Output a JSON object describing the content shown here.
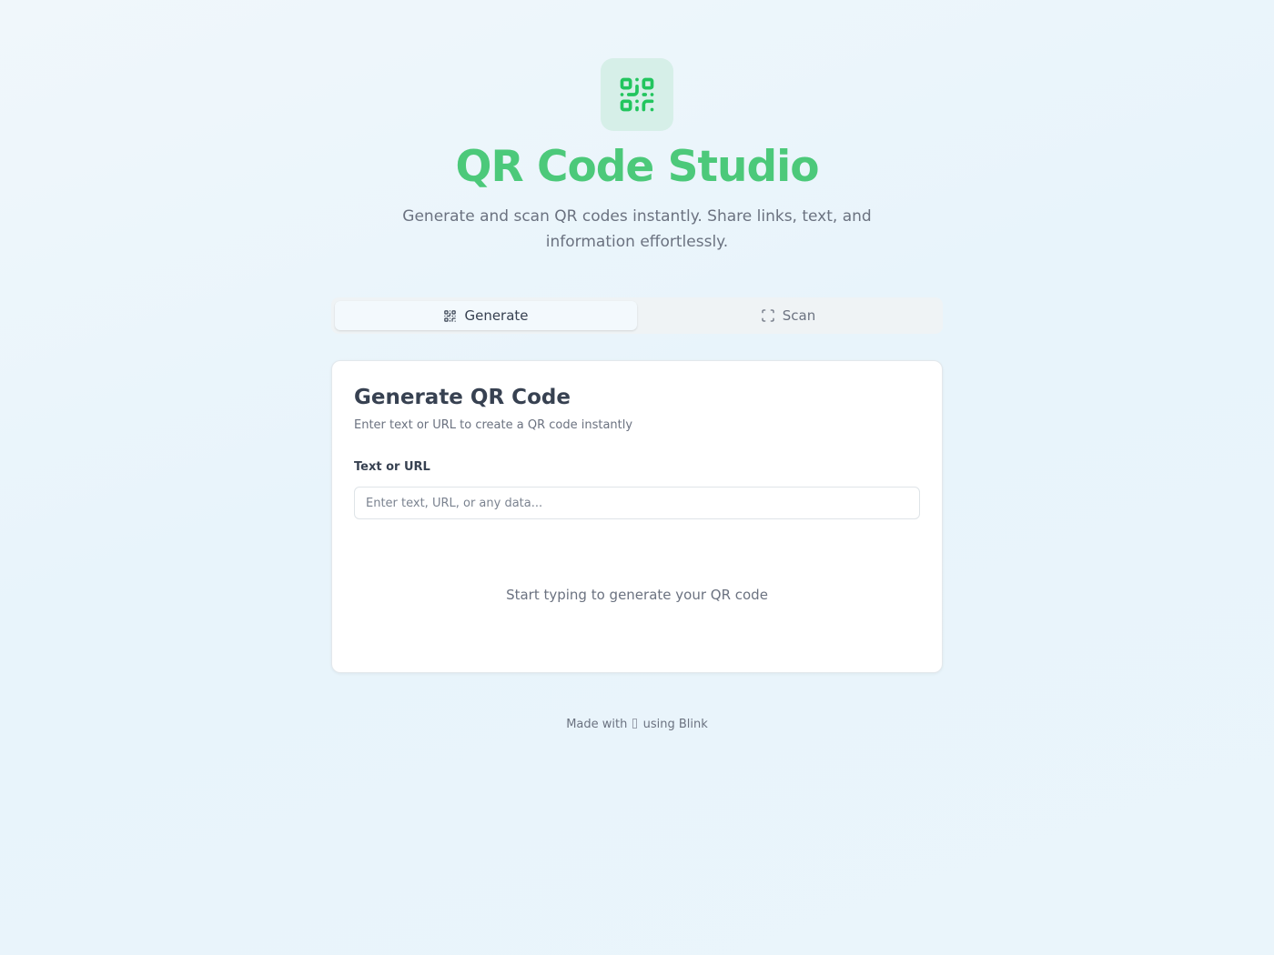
{
  "header": {
    "logo_icon": "qr-code-icon",
    "title": "QR Code Studio",
    "subtitle": "Generate and scan QR codes instantly. Share links, text, and information effortlessly.",
    "accent_color": "#4cc97a"
  },
  "tabs": [
    {
      "label": "Generate",
      "icon": "qr-code-icon",
      "active": true
    },
    {
      "label": "Scan",
      "icon": "scan-icon",
      "active": false
    }
  ],
  "generate_card": {
    "title": "Generate QR Code",
    "description": "Enter text or URL to create a QR code instantly",
    "field_label": "Text or URL",
    "input_value": "",
    "input_placeholder": "Enter text, URL, or any data...",
    "empty_state": "Start typing to generate your QR code"
  },
  "footer": {
    "prefix": "Made with",
    "icon": "heart-icon",
    "suffix": "using Blink"
  }
}
